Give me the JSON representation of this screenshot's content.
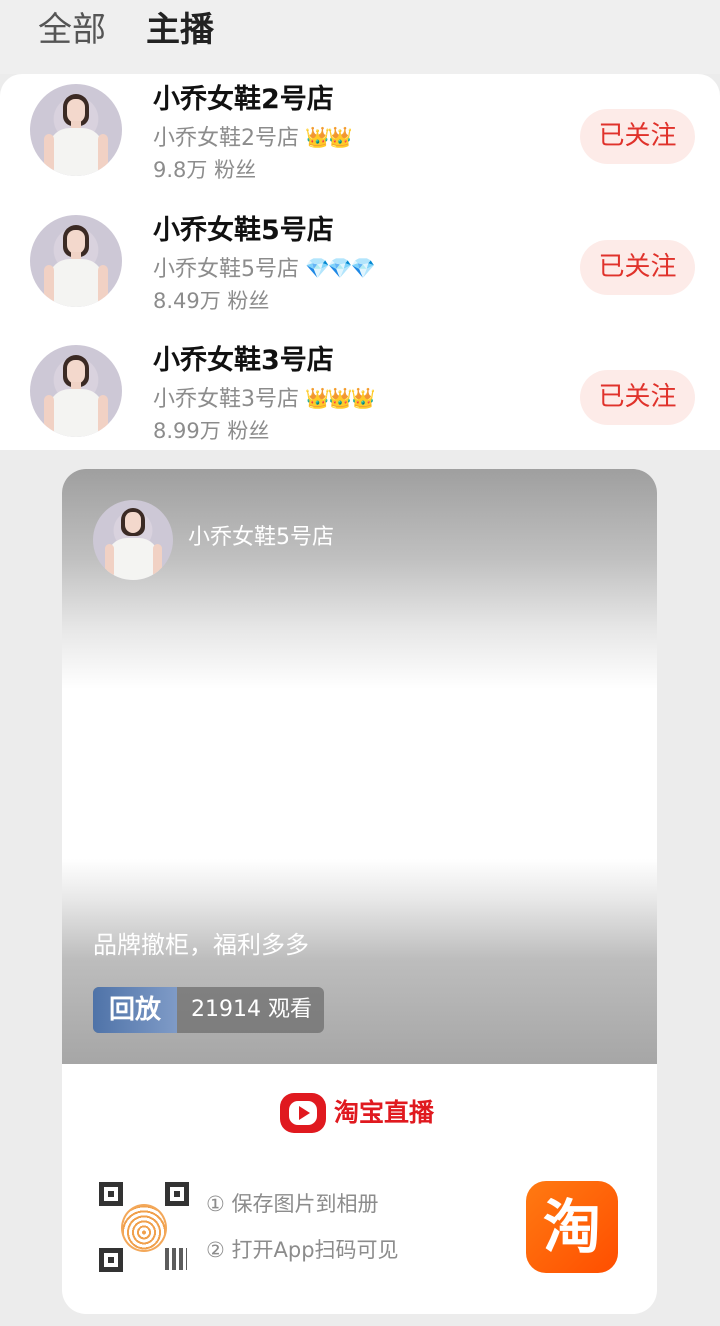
{
  "tabs": [
    {
      "label": "全部"
    },
    {
      "label": "主播"
    }
  ],
  "anchors": [
    {
      "name": "小乔女鞋2号店",
      "sub": "小乔女鞋2号店",
      "badges": "👑👑",
      "fans": "9.8万 粉丝",
      "follow": "已关注"
    },
    {
      "name": "小乔女鞋5号店",
      "sub": "小乔女鞋5号店",
      "badges": "💎💎💎",
      "fans": "8.49万 粉丝",
      "follow": "已关注"
    },
    {
      "name": "小乔女鞋3号店",
      "sub": "小乔女鞋3号店",
      "badges": "👑👑👑",
      "fans": "8.99万 粉丝",
      "follow": "已关注"
    }
  ],
  "card": {
    "anchor_name": "小乔女鞋5号店",
    "slogan": "品牌撤柜，福利多多",
    "replay_tag": "回放",
    "view_count": "21914 观看",
    "brand": "淘宝直播",
    "steps": [
      "① 保存图片到相册",
      "② 打开App扫码可见"
    ],
    "app_icon_glyph": "淘"
  },
  "colors": {
    "accent_red": "#e0322b",
    "follow_bg": "#fdebe8",
    "taobao_orange": "#ff6a00"
  }
}
